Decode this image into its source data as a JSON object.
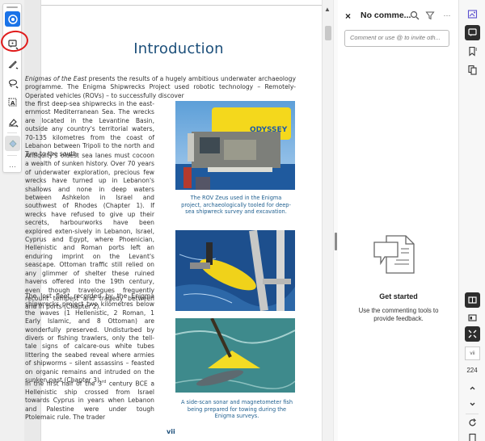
{
  "tools": {
    "items": [
      {
        "name": "select-tool",
        "icon": "hand-pointer-icon",
        "active": true
      },
      {
        "name": "add-comment-tool",
        "icon": "comment-icon",
        "highlighted": true
      },
      {
        "name": "draw-tool",
        "icon": "pencil-icon"
      },
      {
        "name": "lasso-tool",
        "icon": "lasso-icon"
      },
      {
        "name": "text-tool",
        "icon": "text-box-icon"
      },
      {
        "name": "sign-tool",
        "icon": "pen-signature-icon"
      },
      {
        "name": "fill-tool",
        "icon": "fill-bucket-icon",
        "disabled": true
      },
      {
        "name": "more-tools",
        "icon": "ellipsis-icon"
      }
    ],
    "more_label": "···"
  },
  "document": {
    "title": "Introduction",
    "paragraphs": {
      "p1_italic": "Enigmas of the East",
      "p1a": " presents the results of a hugely ambitious underwater archaeology programme. The Enigma Shipwrecks Project used robotic technology – Remotely-Operated vehicles (ROVs) – to successfully discover",
      "p1b": "the first deep-sea shipwrecks in the east-ernmost Mediterranean Sea. The wrecks are located in the Levantine Basin, outside any country's territorial waters, 70-135 kilometres from the coast of Lebanon between Tripoli to the north and Tyre to the south.",
      "p2": "Antiquity's oldest sea lanes must cocoon a wealth of sunken history. Over 70 years of underwater exploration, precious few wrecks have turned up in Lebanon's shallows and none in deep waters between Ashkelon in Israel and southwest of Rhodes (Chapter 1). If wrecks have refused to give up their secrets, harbourworks have been explored exten-sively in Lebanon, Israel, Cyprus and Egypt, where Phoenician, Hellenistic and Roman ports left an enduring imprint on the Levant's seascape. Ottoman traffic still relied on any glimmer of shelter these ruined havens offered into the 19th century, even though travelogues frequently recount tempest and tragedy between and in ports (Chapter 2).",
      "p3": "The lost fleet recorded by the Enigma shipwrecks project two kilometres below the waves (1 Hellenistic, 2 Roman, 1 Early Islamic, and 8 Ottoman) are wonderfully preserved. Undisturbed by divers or fishing trawlers, only the tell-tale signs of calcare-ous white tubes littering the seabed reveal where armies of shipworms – silent assassins – feasted on organic remains and intruded on the sunken past (Chapter 3).",
      "p4a": "In the first half of the 3",
      "p4sup": "rd",
      "p4b": " century BCE a Hellenistic ship crossed from Israel towards Cyprus in years when Lebanon and Palestine were under tough Ptolemaic rule. The trader"
    },
    "figures": [
      {
        "name": "rov-zeus-photo",
        "label": "ODYSSEY",
        "caption": "The ROV Zeus used in the Enigma project, archaeologically tooled for deep-sea shipwreck survey and excavation."
      },
      {
        "name": "sonar-fish-photo",
        "caption": ""
      },
      {
        "name": "magnetometer-photo",
        "caption": "A side-scan sonar and magnetometer fish being prepared for towing during the Enigma surveys."
      }
    ],
    "page_number": "vii"
  },
  "comments_panel": {
    "close_icon": "×",
    "title": "No comme...",
    "input_placeholder": "Comment or use @ to invite oth...",
    "empty_title": "Get started",
    "empty_text": "Use the commenting tools to provide feedback."
  },
  "right_rail": {
    "current_page": "vii",
    "total_pages": "224"
  }
}
